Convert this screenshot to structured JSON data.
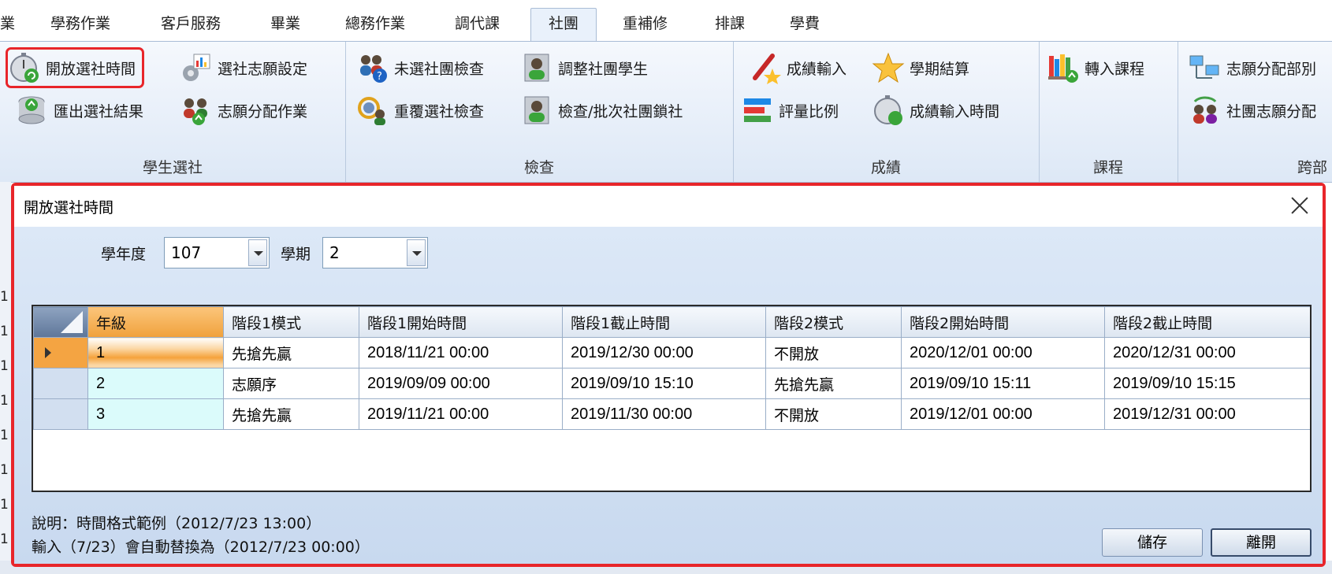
{
  "tabs": [
    "業",
    "學務作業",
    "客戶服務",
    "畢業",
    "總務作業",
    "調代課",
    "社團",
    "重補修",
    "排課",
    "學費"
  ],
  "ribbon": {
    "groups": {
      "student": {
        "label": "學生選社"
      },
      "check": {
        "label": "檢查"
      },
      "score": {
        "label": "成績"
      },
      "course": {
        "label": "課程"
      },
      "cross": {
        "label": "跨部"
      }
    },
    "buttons": {
      "open_time": "開放選社時間",
      "wish_setting": "選社志願設定",
      "export_result": "匯出選社結果",
      "wish_assign": "志願分配作業",
      "unselected_check": "未選社團檢查",
      "adjust_students": "調整社團學生",
      "duplicate_check": "重覆選社檢查",
      "batch_lock": "檢查/批次社團鎖社",
      "score_input": "成績輸入",
      "semester_settle": "學期結算",
      "grading_ratio": "評量比例",
      "score_input_time": "成績輸入時間",
      "import_course": "轉入課程",
      "wish_by_dept": "志願分配部別",
      "club_wish_dist": "社團志願分配"
    }
  },
  "background": {
    "row_numbers": [
      "1",
      "1",
      "1",
      "1",
      "1",
      "1",
      "1",
      "1",
      "1",
      "1",
      "1"
    ]
  },
  "dialog": {
    "title": "開放選社時間",
    "school_year_label": "學年度",
    "school_year_value": "107",
    "semester_label": "學期",
    "semester_value": "2",
    "columns": [
      "年級",
      "階段1模式",
      "階段1開始時間",
      "階段1截止時間",
      "階段2模式",
      "階段2開始時間",
      "階段2截止時間"
    ],
    "rows": [
      [
        "1",
        "先搶先贏",
        "2018/11/21 00:00",
        "2019/12/30 00:00",
        "不開放",
        "2020/12/01 00:00",
        "2020/12/31 00:00"
      ],
      [
        "2",
        "志願序",
        "2019/09/09 00:00",
        "2019/09/10 15:10",
        "先搶先贏",
        "2019/09/10 15:11",
        "2019/09/10 15:15"
      ],
      [
        "3",
        "先搶先贏",
        "2019/11/21 00:00",
        "2019/11/30 00:00",
        "不開放",
        "2019/12/01 00:00",
        "2019/12/31 00:00"
      ]
    ],
    "note_line1": "說明：時間格式範例（2012/7/23 13:00）",
    "note_line2": "輸入（7/23）會自動替換為（2012/7/23 00:00）",
    "save_label": "儲存",
    "leave_label": "離開"
  },
  "colors": {
    "highlight": "#e8252a",
    "selected_row": "#f4a442",
    "grade_cell": "#dbfbfb"
  }
}
